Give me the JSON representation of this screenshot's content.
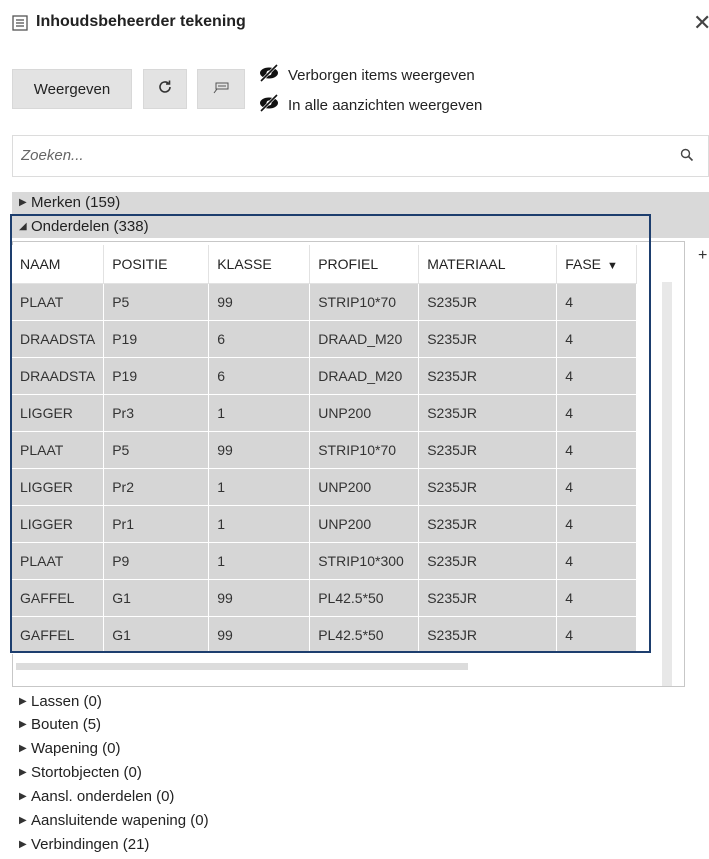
{
  "window": {
    "title": "Inhoudsbeheerder tekening",
    "close_glyph": "✕"
  },
  "toolbar": {
    "show_label": "Weergeven",
    "refresh_icon": "refresh-icon",
    "tag_icon": "tag-icon",
    "option_hidden_items": "Verborgen items weergeven",
    "option_all_views": "In alle aanzichten weergeven"
  },
  "search": {
    "placeholder": "Zoeken...",
    "value": ""
  },
  "tree": {
    "merken": "Merken (159)",
    "onderdelen": "Onderdelen (338)",
    "lassen": "Lassen (0)",
    "bouten": "Bouten (5)",
    "wapening": "Wapening (0)",
    "stortobjecten": "Stortobjecten (0)",
    "aansl_onderdelen": "Aansl. onderdelen (0)",
    "aansluitende_wapening": "Aansluitende wapening (0)",
    "verbindingen": "Verbindingen (21)"
  },
  "grid": {
    "columns": [
      "NAAM",
      "POSITIE",
      "KLASSE",
      "PROFIEL",
      "MATERIAAL",
      "FASE"
    ],
    "sort_glyph": "▼",
    "rows": [
      [
        "PLAAT",
        "P5",
        "99",
        "STRIP10*70",
        "S235JR",
        "4"
      ],
      [
        "DRAADSTA",
        "P19",
        "6",
        "DRAAD_M20",
        "S235JR",
        "4"
      ],
      [
        "DRAADSTA",
        "P19",
        "6",
        "DRAAD_M20",
        "S235JR",
        "4"
      ],
      [
        "LIGGER",
        "Pr3",
        "1",
        "UNP200",
        "S235JR",
        "4"
      ],
      [
        "PLAAT",
        "P5",
        "99",
        "STRIP10*70",
        "S235JR",
        "4"
      ],
      [
        "LIGGER",
        "Pr2",
        "1",
        "UNP200",
        "S235JR",
        "4"
      ],
      [
        "LIGGER",
        "Pr1",
        "1",
        "UNP200",
        "S235JR",
        "4"
      ],
      [
        "PLAAT",
        "P9",
        "1",
        "STRIP10*300",
        "S235JR",
        "4"
      ],
      [
        "GAFFEL",
        "G1",
        "99",
        "PL42.5*50",
        "S235JR",
        "4"
      ],
      [
        "GAFFEL",
        "G1",
        "99",
        "PL42.5*50",
        "S235JR",
        "4"
      ]
    ],
    "add_column_glyph": "+"
  },
  "colors": {
    "selection_frame": "#1d3e6e",
    "row_background": "#d6d6d6"
  }
}
